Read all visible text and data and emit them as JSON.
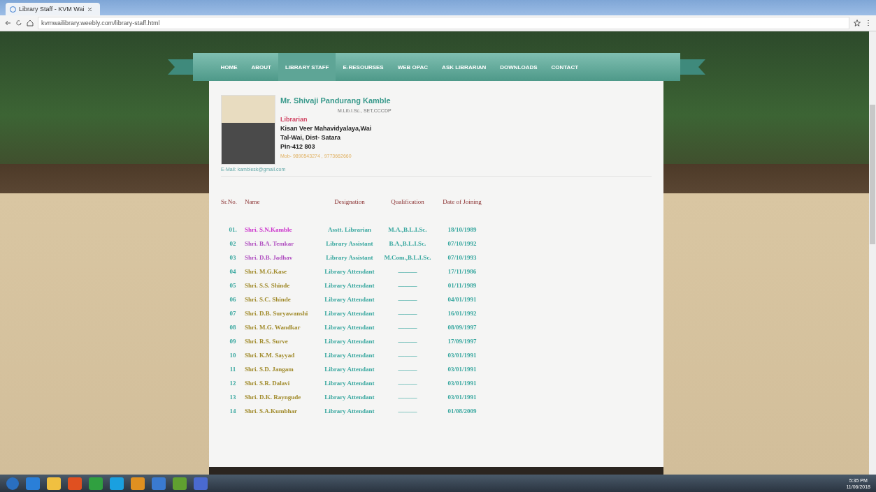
{
  "browser": {
    "tab_title": "Library Staff - KVM Wai",
    "url": "kvmwailibrary.weebly.com/library-staff.html"
  },
  "nav": [
    {
      "label": "HOME",
      "selected": false
    },
    {
      "label": "ABOUT",
      "selected": false
    },
    {
      "label": "LIBRARY STAFF",
      "selected": true
    },
    {
      "label": "E-RESOURSES",
      "selected": false
    },
    {
      "label": "WEB OPAC",
      "selected": false
    },
    {
      "label": "ASK LIBRARIAN",
      "selected": false
    },
    {
      "label": "DOWNLOADS",
      "selected": false
    },
    {
      "label": "CONTACT",
      "selected": false
    }
  ],
  "profile": {
    "name": "Mr. Shivaji Pandurang Kamble",
    "qualification": "M.Lib.I.Sc., SET,CCCDP",
    "designation": "Librarian",
    "college": "Kisan Veer Mahavidyalaya,Wai",
    "address": "Tal-Wai, Dist- Satara",
    "pin": "Pin-412 803",
    "mobile": "Mob- 9890543274 , 9773662660",
    "email": "E-Mail: kamblesk@gmail.com"
  },
  "staff_table": {
    "columns": [
      "Sr.No.",
      "Name",
      "Designation",
      "Qualification",
      "Date of Joining"
    ],
    "rows": [
      {
        "sr": "01.",
        "name": "Shri. S.N.Kamble",
        "color": "#cc33cc",
        "designation": "Asstt. Librarian",
        "qualification": "M.A.,B.L.I.Sc.",
        "date": "18/10/1989"
      },
      {
        "sr": "02",
        "name": "Shri. B.A. Temkar",
        "color": "#b050c0",
        "designation": "Library Assistant",
        "qualification": "B.A.,B.L.I.Sc.",
        "date": "07/10/1992"
      },
      {
        "sr": "03",
        "name": "Shri. D.B. Jadhav",
        "color": "#b050c0",
        "designation": "Library Assistant",
        "qualification": "M.Com.,B.L.I.Sc.",
        "date": "07/10/1993"
      },
      {
        "sr": "04",
        "name": "Shri. M.G.Kase",
        "color": "#a08a2a",
        "designation": "Library Attendant",
        "qualification": "———",
        "date": "17/11/1986"
      },
      {
        "sr": "05",
        "name": "Shri. S.S. Shinde",
        "color": "#a08a2a",
        "designation": "Library Attendant",
        "qualification": "———",
        "date": "01/11/1989"
      },
      {
        "sr": "06",
        "name": "Shri. S.C. Shinde",
        "color": "#a08a2a",
        "designation": "Library Attendant",
        "qualification": "———",
        "date": "04/01/1991"
      },
      {
        "sr": "07",
        "name": "Shri. D.B. Suryawanshi",
        "color": "#a08a2a",
        "designation": "Library Attendant",
        "qualification": "———",
        "date": "16/01/1992"
      },
      {
        "sr": "08",
        "name": "Shri. M.G. Wandkar",
        "color": "#a08a2a",
        "designation": "Library Attendant",
        "qualification": "———",
        "date": "08/09/1997"
      },
      {
        "sr": "09",
        "name": "Shri. R.S. Surve",
        "color": "#a08a2a",
        "designation": "Library Attendant",
        "qualification": "———",
        "date": "17/09/1997"
      },
      {
        "sr": "10",
        "name": "Shri. K.M. Sayyad",
        "color": "#a08a2a",
        "designation": "Library Attendant",
        "qualification": "———",
        "date": "03/01/1991"
      },
      {
        "sr": "11",
        "name": "Shri. S.D. Jangam",
        "color": "#a08a2a",
        "designation": "Library Attendant",
        "qualification": "———",
        "date": "03/01/1991"
      },
      {
        "sr": "12",
        "name": "Shri. S.R. Dalavi",
        "color": "#a08a2a",
        "designation": "Library Attendant",
        "qualification": "———",
        "date": "03/01/1991"
      },
      {
        "sr": "13",
        "name": "Shri. D.K. Rayngude",
        "color": "#a08a2a",
        "designation": "Library Attendant",
        "qualification": "———",
        "date": "03/01/1991"
      },
      {
        "sr": "14",
        "name": "Shri. S.A.Kumbhar",
        "color": "#a08a2a",
        "designation": "Library Attendant",
        "qualification": "———",
        "date": "01/08/2009"
      }
    ]
  },
  "taskbar": {
    "time": "5:35 PM",
    "date": "11/06/2018"
  }
}
